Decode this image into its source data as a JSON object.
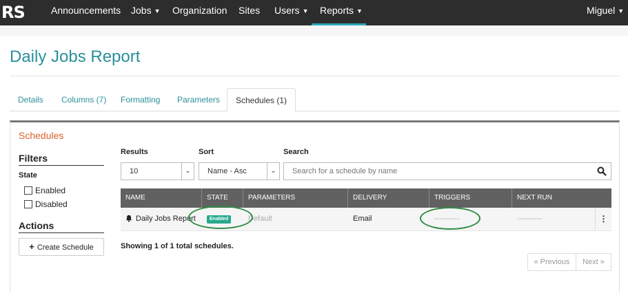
{
  "nav": {
    "logo": "RS",
    "items": [
      {
        "label": "Announcements",
        "caret": ""
      },
      {
        "label": "Jobs",
        "caret": "▼"
      },
      {
        "label": "Organization",
        "caret": ""
      },
      {
        "label": "Sites",
        "caret": ""
      },
      {
        "label": "Users",
        "caret": "▼"
      },
      {
        "label": "Reports",
        "caret": "▼"
      }
    ],
    "user": "Miguel",
    "user_caret": "▼",
    "active_item": "Reports",
    "active_color": "#2aa7b5"
  },
  "page": {
    "title": "Daily Jobs Report",
    "title_color": "#2a8f9b"
  },
  "tabs": [
    {
      "label": "Details"
    },
    {
      "label": "Columns (7)"
    },
    {
      "label": "Formatting"
    },
    {
      "label": "Parameters"
    },
    {
      "label": "Schedules (1)"
    }
  ],
  "active_tab": "Schedules (1)",
  "panel": {
    "title": "Schedules",
    "title_color": "#d9622b"
  },
  "filters": {
    "heading": "Filters",
    "state_label": "State",
    "options": [
      {
        "label": "Enabled",
        "checked": false
      },
      {
        "label": "Disabled",
        "checked": false
      }
    ]
  },
  "actions": {
    "heading": "Actions",
    "create_button": "Create Schedule",
    "create_icon": "plus-icon"
  },
  "controls": {
    "results_label": "Results",
    "results_value": "10",
    "sort_label": "Sort",
    "sort_value": "Name - Asc",
    "search_label": "Search",
    "search_placeholder": "Search for a schedule by name",
    "search_icon": "search-icon"
  },
  "table": {
    "columns": [
      "NAME",
      "STATE",
      "PARAMETERS",
      "DELIVERY",
      "TRIGGERS",
      "NEXT RUN"
    ],
    "rows": [
      {
        "name": "Daily Jobs Report",
        "name_icon": "bell-icon",
        "state": "Enabled",
        "state_color": "#27a98c",
        "parameters": "Default",
        "delivery": "Email",
        "triggers": "----------",
        "next_run": "----------",
        "menu_icon": "kebab-menu-icon"
      }
    ]
  },
  "summary": "Showing 1 of 1 total schedules.",
  "pagination": {
    "prev": "« Previous",
    "next": "Next »"
  }
}
